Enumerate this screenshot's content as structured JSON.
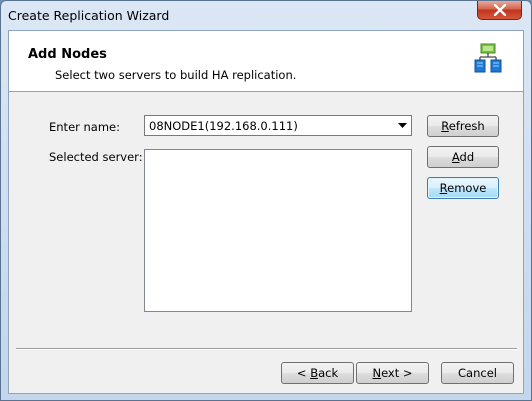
{
  "window": {
    "title": "Create Replication Wizard"
  },
  "header": {
    "title": "Add Nodes",
    "subtitle": "Select two servers to build HA replication.",
    "icon": "network-servers-icon"
  },
  "form": {
    "enter_name_label": "Enter name:",
    "enter_name_value": "08NODE1(192.168.0.111)",
    "selected_server_label": "Selected server:",
    "selected_servers": []
  },
  "side_buttons": {
    "refresh": {
      "pre": "",
      "key": "R",
      "post": "efresh"
    },
    "add": {
      "pre": "",
      "key": "A",
      "post": "dd"
    },
    "remove": {
      "pre": "",
      "key": "R",
      "post": "emove"
    }
  },
  "footer": {
    "back": {
      "pre": "< ",
      "key": "B",
      "post": "ack"
    },
    "next": {
      "pre": "",
      "key": "N",
      "post": "ext >"
    },
    "cancel": "Cancel"
  },
  "colors": {
    "accent": "#3c7fb1",
    "close": "#c2331a",
    "icon_blue": "#1e7ad6",
    "icon_green": "#7cc242"
  }
}
